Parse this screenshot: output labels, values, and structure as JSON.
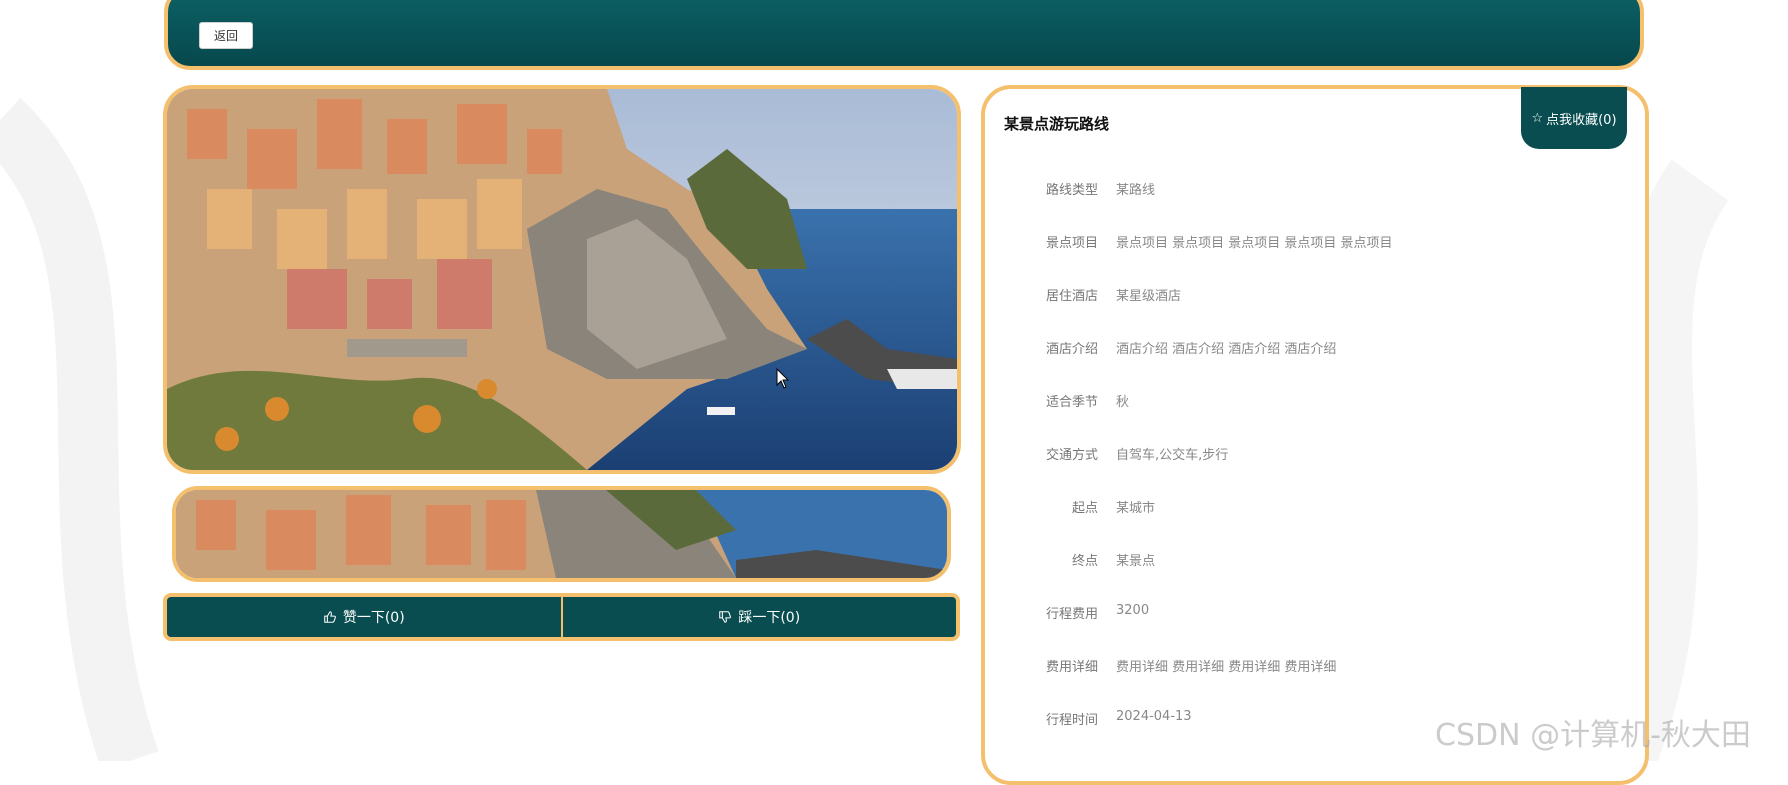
{
  "header": {
    "back_label": "返回"
  },
  "gallery": {
    "vote": {
      "like_label": "赞一下(0)",
      "dislike_label": "踩一下(0)"
    }
  },
  "info": {
    "title": "某景点游玩路线",
    "favorite_label": "点我收藏(0)",
    "rows": [
      {
        "label": "路线类型",
        "value": "某路线"
      },
      {
        "label": "景点项目",
        "value": "景点项目 景点项目 景点项目 景点项目 景点项目"
      },
      {
        "label": "居住酒店",
        "value": "某星级酒店"
      },
      {
        "label": "酒店介绍",
        "value": "酒店介绍 酒店介绍 酒店介绍 酒店介绍"
      },
      {
        "label": "适合季节",
        "value": "秋"
      },
      {
        "label": "交通方式",
        "value": "自驾车,公交车,步行"
      },
      {
        "label": "起点",
        "value": "某城市"
      },
      {
        "label": "终点",
        "value": "某景点"
      },
      {
        "label": "行程费用",
        "value": "3200"
      },
      {
        "label": "费用详细",
        "value": "费用详细 费用详细 费用详细 费用详细"
      },
      {
        "label": "行程时间",
        "value": "2024-04-13"
      }
    ]
  },
  "watermark": "CSDN @计算机-秋大田",
  "colors": {
    "accent": "#094d50",
    "border": "#f5c06e"
  }
}
